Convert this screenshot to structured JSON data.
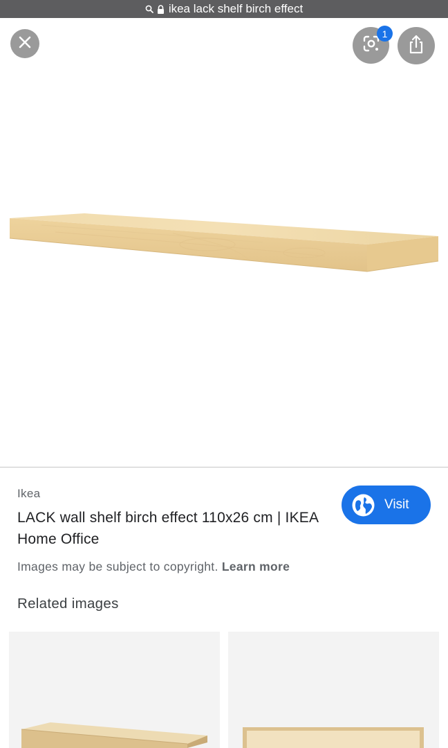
{
  "url_bar": {
    "text": "ikea lack shelf birch effect"
  },
  "lens_badge_count": "1",
  "result": {
    "source": "Ikea",
    "title": "LACK wall shelf birch effect 110x26 cm | IKEA Home Office",
    "visit_label": "Visit",
    "copyright_text": "Images may be subject to copyright.",
    "learn_more": "Learn more"
  },
  "related": {
    "heading": "Related images"
  },
  "colors": {
    "accent": "#1a73e8",
    "shelf_wood": "#edd7a8"
  }
}
